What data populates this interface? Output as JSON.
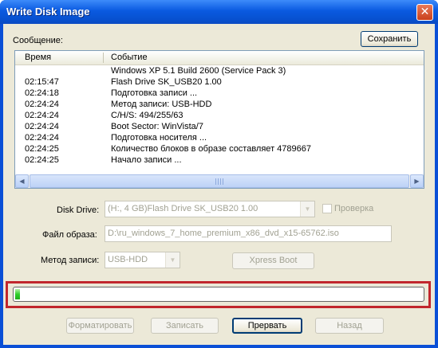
{
  "window": {
    "title": "Write Disk Image"
  },
  "message": {
    "label": "Сообщение:",
    "save_button": "Сохранить"
  },
  "log": {
    "columns": [
      "Время",
      "Событие"
    ],
    "rows": [
      {
        "time": "",
        "event": "Windows XP 5.1 Build 2600 (Service Pack 3)"
      },
      {
        "time": "02:15:47",
        "event": "Flash   Drive SK_USB20 1.00"
      },
      {
        "time": "02:24:18",
        "event": "Подготовка записи ..."
      },
      {
        "time": "02:24:24",
        "event": "Метод записи: USB-HDD"
      },
      {
        "time": "02:24:24",
        "event": "C/H/S: 494/255/63"
      },
      {
        "time": "02:24:24",
        "event": "Boot Sector: WinVista/7"
      },
      {
        "time": "02:24:24",
        "event": "Подготовка носителя ..."
      },
      {
        "time": "02:24:25",
        "event": "Количество блоков в образе составляет 4789667"
      },
      {
        "time": "02:24:25",
        "event": "Начало записи ..."
      }
    ]
  },
  "form": {
    "disk_drive_label": "Disk Drive:",
    "disk_drive_value": "(H:, 4 GB)Flash   Drive SK_USB20  1.00",
    "verify_label": "Проверка",
    "verify_checked": false,
    "image_file_label": "Файл образа:",
    "image_file_value": "D:\\ru_windows_7_home_premium_x86_dvd_x15-65762.iso",
    "write_method_label": "Метод записи:",
    "write_method_value": "USB-HDD",
    "xpress_boot_button": "Xpress Boot"
  },
  "progress": {
    "percent": 1,
    "fill_color": "#2fcf2a",
    "highlight_color": "#c1272d"
  },
  "buttons": {
    "format": "Форматировать",
    "write": "Записать",
    "abort": "Прервать",
    "back": "Назад"
  },
  "icons": {
    "close": "close-icon",
    "dropdown": "chevron-down-icon"
  }
}
